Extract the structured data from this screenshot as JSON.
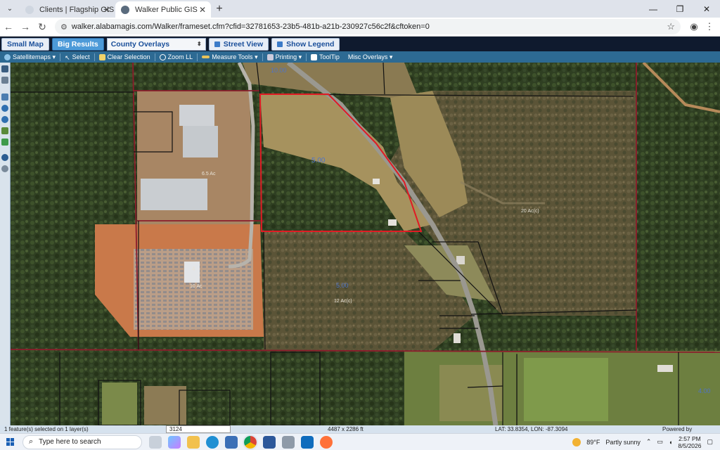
{
  "browser": {
    "tabs": [
      {
        "title": "Clients | Flagship GIS",
        "active": false
      },
      {
        "title": "Walker Public GIS",
        "active": true
      }
    ],
    "new_tab": "+",
    "url": "walker.alabamagis.com/Walker/frameset.cfm?cfid=32781653-23b5-481b-a21b-230927c56c2f&cftoken=0"
  },
  "gis_header": {
    "small_map": "Small Map",
    "big_results": "Big Results",
    "overlays_select": "County Overlays",
    "street_view": "Street View",
    "show_legend": "Show Legend"
  },
  "toolbar": {
    "satellite": "Satellitemaps",
    "select": "Select",
    "clear_selection": "Clear Selection",
    "zoom_ll": "Zoom LL",
    "measure_tools": "Measure Tools",
    "printing": "Printing",
    "tooltip": "ToolTip",
    "misc_overlays": "Misc Overlays"
  },
  "map": {
    "labels": {
      "acres_center": "5.00",
      "area_left": "6.5 Ac",
      "area_mid": "10 Ac",
      "area_right": "20 Ac(c)",
      "area_lower": "12 Ac(c)",
      "val_lower": "5.00",
      "val_bottom_right": "4.00",
      "val_top": "10.00",
      "lot_4": "4"
    }
  },
  "status": {
    "selected": "1 feature(s) selected on 1 layer(s)",
    "parcel_input": "3124",
    "dimensions": "4487 x 2286 ft",
    "coords": "LAT: 33.8354, LON: -87.3094",
    "powered_by": "Powered by"
  },
  "taskbar": {
    "search_placeholder": "Type here to search",
    "weather_temp": "89°F",
    "weather_desc": "Partly sunny",
    "time": "2:57 PM",
    "date": "8/5/2026"
  },
  "colors": {
    "parcel_line": "#8b1c2b",
    "selected_parcel": "#e01b24",
    "toolbar_bg": "#2d6a93"
  }
}
